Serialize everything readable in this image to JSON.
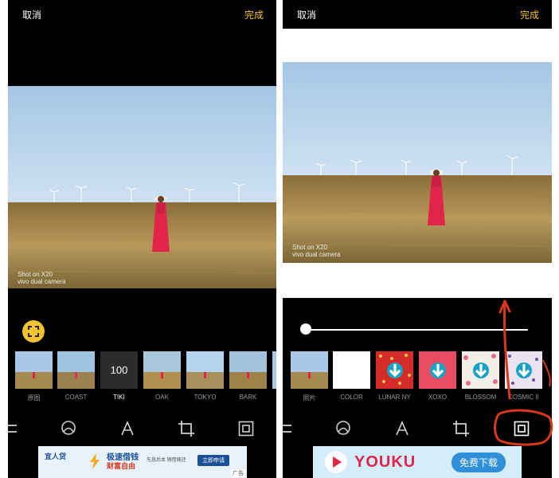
{
  "left": {
    "cancel_label": "取消",
    "done_label": "完成",
    "watermark_line1": "Shot on X20",
    "watermark_line2": "vivo dual camera",
    "filters": [
      {
        "label": "原图",
        "active": false
      },
      {
        "label": "COAST",
        "active": false
      },
      {
        "label": "TIKI",
        "active": true,
        "value": "100"
      },
      {
        "label": "OAK",
        "active": false
      },
      {
        "label": "TOKYO",
        "active": false
      },
      {
        "label": "BARK",
        "active": false
      }
    ],
    "ad": {
      "brand": "宜人贷",
      "headline": "极速借钱",
      "subline": "财富自由",
      "detail": "先息后本 随借随还",
      "cta": "立即申请",
      "tag": "广告"
    }
  },
  "right": {
    "cancel_label": "取消",
    "done_label": "完成",
    "watermark_line1": "Shot on X20",
    "watermark_line2": "vivo dual camera",
    "slider_value": 0,
    "frames": [
      {
        "label": "照片"
      },
      {
        "label": "COLOR"
      },
      {
        "label": "LUNAR NY"
      },
      {
        "label": "XOXO"
      },
      {
        "label": "BLOSSOM"
      },
      {
        "label": "COSMIC II"
      }
    ],
    "ad": {
      "brand": "YOUKU",
      "cta": "免费下载"
    }
  },
  "colors": {
    "accent": "#f2c230",
    "annotation": "#d8391d",
    "sky": "#a9cbe8",
    "field": "#a48a4e",
    "dress": "#e0244a"
  },
  "icons": {
    "toolbar": [
      "adjust-icon",
      "filter-icon",
      "text-icon",
      "crop-icon",
      "frame-icon"
    ]
  }
}
